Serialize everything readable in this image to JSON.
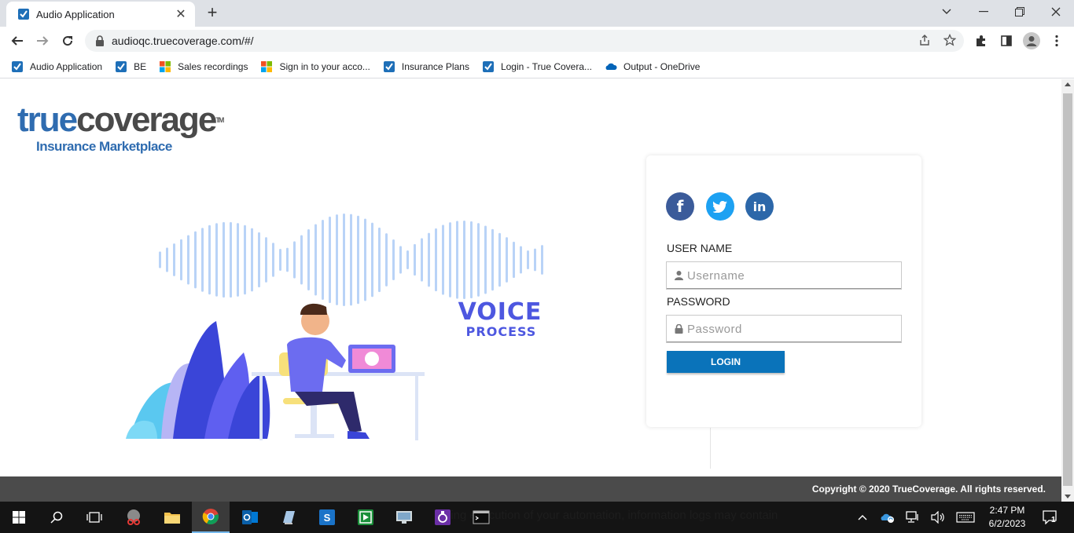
{
  "browser": {
    "tab_title": "Audio Application",
    "tab_close": "✕",
    "new_tab": "+",
    "url": "audioqc.truecoverage.com/#/",
    "bookmarks": [
      {
        "label": "Audio Application",
        "icon": "checkbox-icon"
      },
      {
        "label": "BE",
        "icon": "checkbox-icon"
      },
      {
        "label": "Sales recordings",
        "icon": "microsoft-icon"
      },
      {
        "label": "Sign in to your acco...",
        "icon": "microsoft-icon"
      },
      {
        "label": "Insurance Plans",
        "icon": "checkbox-icon"
      },
      {
        "label": "Login - True Covera...",
        "icon": "checkbox-icon"
      },
      {
        "label": "Output - OneDrive",
        "icon": "onedrive-icon"
      }
    ]
  },
  "page": {
    "logo": {
      "part1": "true",
      "part2": "coverage",
      "tm": "TM",
      "subtitle": "Insurance Marketplace"
    },
    "illustration": {
      "line1": "VOICE",
      "line2": "PROCESS"
    },
    "social": {
      "facebook": "f",
      "twitter": "t",
      "linkedin": "in"
    },
    "login": {
      "username_label": "USER NAME",
      "username_placeholder": "Username",
      "password_label": "PASSWORD",
      "password_placeholder": "Password",
      "button": "LOGIN"
    },
    "footer": "Copyright © 2020 TrueCoverage. All rights reserved."
  },
  "taskbar": {
    "background_text": "uring execution of your automation, information logs may contain",
    "time": "2:47 PM",
    "date": "6/2/2023",
    "notification_count": "1"
  },
  "colors": {
    "brand_blue": "#2f6cb0",
    "login_button": "#0a73ba",
    "facebook": "#3b5b9a",
    "twitter": "#1da1f2",
    "linkedin": "#2c67a9",
    "voice_text": "#4d57e0",
    "footer_bg": "#4b4b4b"
  }
}
